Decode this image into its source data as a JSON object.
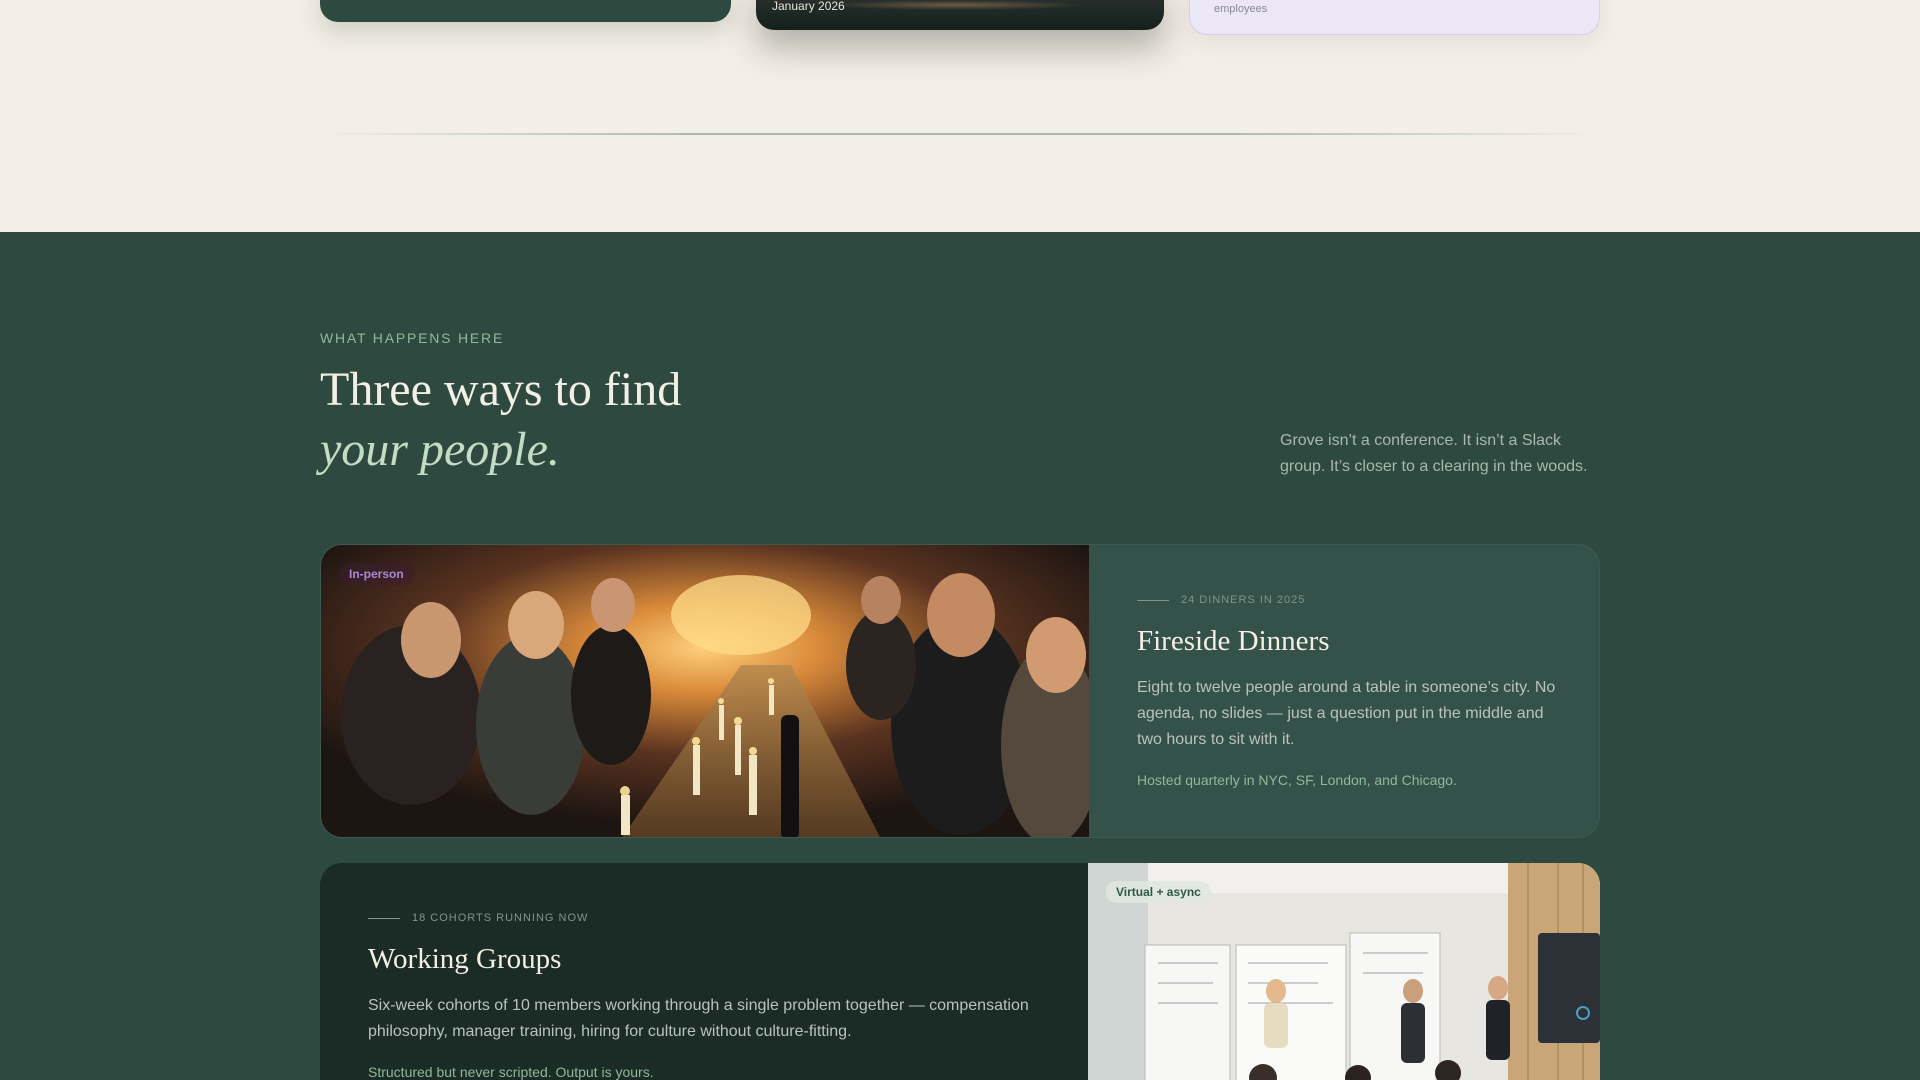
{
  "top_cards": {
    "card2_caption": "January 2026",
    "card3_caption": "employees"
  },
  "section": {
    "eyebrow": "WHAT HAPPENS HERE",
    "heading_line1": "Three ways to find",
    "heading_line2": "your people.",
    "intro": "Grove isn’t a conference. It isn’t a Slack group. It’s closer to a clearing in the woods."
  },
  "cards": [
    {
      "badge": "In-person",
      "meta": "24 DINNERS IN 2025",
      "title": "Fireside Dinners",
      "description": "Eight to twelve people around a table in someone’s city. No agenda, no slides — just a question put in the middle and two hours to sit with it.",
      "note": "Hosted quarterly in NYC, SF, London, and Chicago."
    },
    {
      "badge": "Virtual + async",
      "meta": "18 COHORTS RUNNING NOW",
      "title": "Working Groups",
      "description": "Six-week cohorts of 10 members working through a single problem together — compensation philosophy, manager training, hiring for culture without culture-fitting.",
      "note": "Structured but never scripted. Output is yours."
    }
  ],
  "colors": {
    "cream": "#f4efe6",
    "forest": "#2e4a40",
    "forest_dark": "#1b2b26",
    "sage": "#8fb89c",
    "lavender": "#a78ad6"
  }
}
